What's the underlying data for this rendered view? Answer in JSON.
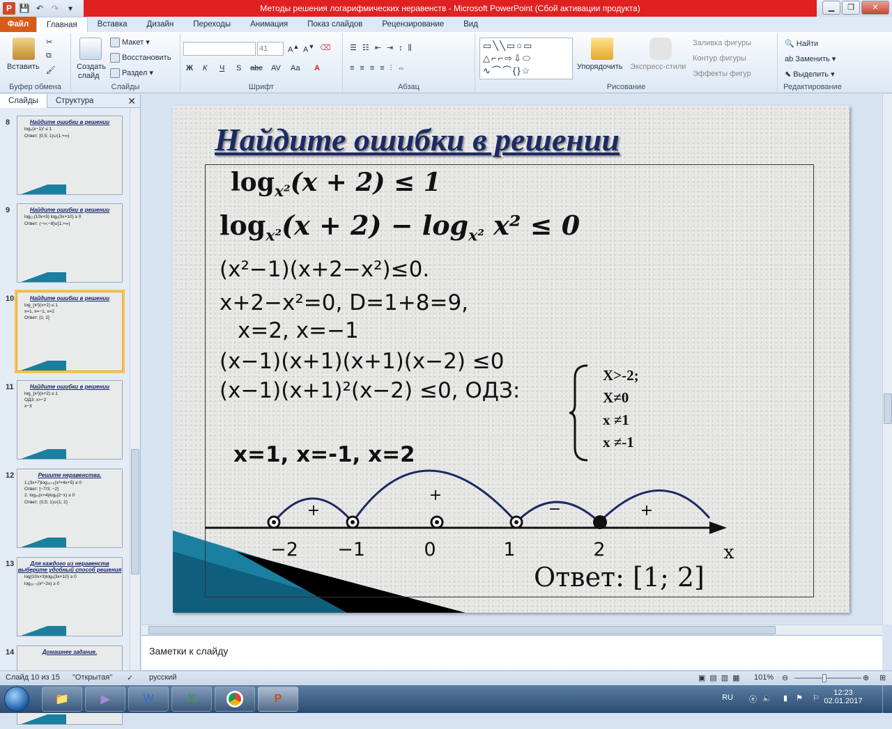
{
  "window": {
    "title": "Методы решения логарифмических неравенств  -  Microsoft PowerPoint (Сбой активации продукта)"
  },
  "tabs": [
    "Главная",
    "Вставка",
    "Дизайн",
    "Переходы",
    "Анимация",
    "Показ слайдов",
    "Рецензирование",
    "Вид"
  ],
  "file_tab": "Файл",
  "ribbon": {
    "clipboard": {
      "paste": "Вставить",
      "label": "Буфер обмена"
    },
    "slides": {
      "create": "Создать",
      "create2": "слайд",
      "layout": "Макет",
      "reset": "Восстановить",
      "section": "Раздел",
      "label": "Слайды"
    },
    "font": {
      "size": "41",
      "label": "Шрифт",
      "bold": "Ж",
      "italic": "К",
      "underline": "Ч",
      "strike": "S",
      "abc": "abc",
      "aa": "Аа"
    },
    "paragraph": {
      "label": "Абзац"
    },
    "drawing": {
      "arrange": "Упорядочить",
      "quick": "Экспресс-стили",
      "fill": "Заливка фигуры",
      "outline": "Контур фигуры",
      "effects": "Эффекты фигур",
      "label": "Рисование"
    },
    "editing": {
      "find": "Найти",
      "replace": "Заменить",
      "select": "Выделить",
      "label": "Редактирование"
    }
  },
  "panel": {
    "tab_slides": "Слайды",
    "tab_outline": "Структура"
  },
  "thumbnails": [
    {
      "num": "8",
      "title": "Найдите ошибки в решении",
      "lines": [
        "log₂(x−1)² ≤ 1",
        "Ответ: [0,5; 1)∪(1;+∞)"
      ]
    },
    {
      "num": "9",
      "title": "Найдите ошибки в решении",
      "lines": [
        "log₁₀(10x+3) logₓ(3x+10) ≥ 0",
        "Ответ: (−∞;−8]∪[1;+∞)"
      ]
    },
    {
      "num": "10",
      "title": "Найдите ошибки в решении",
      "lines": [
        "log_{x²}(x+2) ≤ 1",
        "x=1, x=−1, x=2",
        "Ответ: [1; 2]"
      ]
    },
    {
      "num": "11",
      "title": "Найдите ошибки в решении",
      "lines": [
        "log_{x²}(x+2) ≤ 1",
        "ОДЗ: x>−2",
        "x−3"
      ]
    },
    {
      "num": "12",
      "title": "Решите неравенства.",
      "lines": [
        "1.(3x+7)log₂ₓ₊₅(x²+4x+5) ≤ 0",
        "Ответ: [−7/3; −2)",
        "2. log₂ₓ(x+4)logₓ(2−x) ≤ 0",
        "Ответ: (0,5; 1)∪(1; 2)"
      ]
    },
    {
      "num": "13",
      "title": "Для каждого из неравенств выберите удобный способ решения",
      "lines": [
        "log(10x+3)logₓ(3x+10) ≥ 0",
        "log₂ₓ₋₁(x²−2x) ≥ 0"
      ]
    },
    {
      "num": "14",
      "title": "Домашнее задание.",
      "lines": []
    }
  ],
  "slide": {
    "title": "Найдите ошибки в решении",
    "line1": "log",
    "line1_sub": "x²",
    "line1_rest": "(x + 2) ≤ 1",
    "line2": "log",
    "line2_sub": "x²",
    "line2_rest": "(x + 2) − log",
    "line2_sub2": "x²",
    "line2_end": " x² ≤ 0",
    "line3": "(x²−1)(x+2−x²)≤0.",
    "line4": "x+2−x²=0,    D=1+8=9,",
    "line5": "x=2, x=−1",
    "line6": "(x−1)(x+1)(x+1)(x−2) ≤0",
    "line7": "(x−1)(x+1)²(x−2) ≤0,  ОДЗ:",
    "line8": "x=1, x=-1, x=2",
    "odz": [
      "X>-2;",
      "X≠0",
      "x ≠1",
      "x ≠-1"
    ],
    "signs": [
      "+",
      "+",
      "−",
      "+"
    ],
    "ticks": [
      "−2",
      "−1",
      "0",
      "1",
      "2"
    ],
    "axis_label": "x",
    "answer": "Ответ: [1; 2]"
  },
  "notes": {
    "placeholder": "Заметки к слайду"
  },
  "status": {
    "slide": "Слайд 10 из 15",
    "theme": "\"Открытая\"",
    "lang": "русский",
    "zoom": "101%"
  },
  "tray": {
    "lang": "RU",
    "time": "12:23",
    "date": "02.01.2017"
  }
}
